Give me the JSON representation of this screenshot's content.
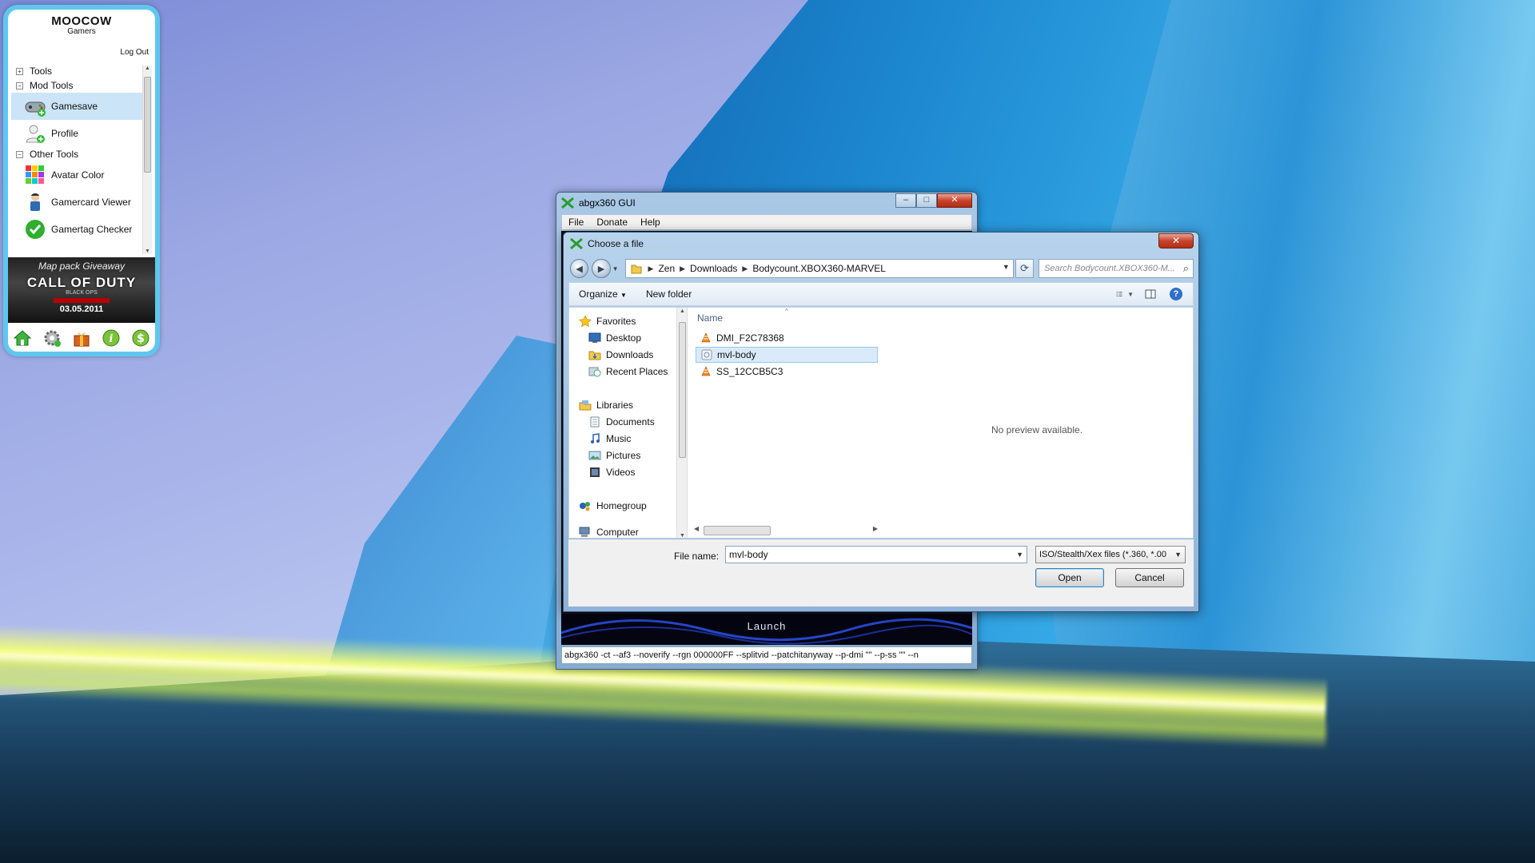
{
  "gadget": {
    "title": "MOOCOW",
    "subtitle": "Gamers",
    "logout": "Log Out",
    "groups": {
      "tools": "Tools",
      "mod_tools": "Mod Tools",
      "other_tools": "Other Tools"
    },
    "items": {
      "gamesave": "Gamesave",
      "profile": "Profile",
      "avatar_color": "Avatar Color",
      "gamercard_viewer": "Gamercard Viewer",
      "gamertag_checker": "Gamertag Checker"
    },
    "banner": {
      "top": "Map pack Giveaway",
      "game": "CALL OF DUTY",
      "sub": "BLACK OPS",
      "date": "03.05.2011"
    },
    "toolbar_icons": [
      "home-icon",
      "settings-icon",
      "gift-icon",
      "info-icon",
      "dollar-icon"
    ]
  },
  "abgx": {
    "title": "abgx360 GUI",
    "menu": [
      "File",
      "Donate",
      "Help"
    ],
    "launch": "Launch",
    "command": "abgx360 -ct --af3 --noverify --rgn 000000FF --splitvid --patchitanyway --p-dmi \"\" --p-ss \"\" --n"
  },
  "dialog": {
    "title": "Choose a file",
    "breadcrumbs": [
      "Zen",
      "Downloads",
      "Bodycount.XBOX360-MARVEL"
    ],
    "search_placeholder": "Search Bodycount.XBOX360-M...",
    "toolbar": {
      "organize": "Organize",
      "new_folder": "New folder"
    },
    "nav": {
      "favorites": "Favorites",
      "desktop": "Desktop",
      "downloads": "Downloads",
      "recent_places": "Recent Places",
      "libraries": "Libraries",
      "documents": "Documents",
      "music": "Music",
      "pictures": "Pictures",
      "videos": "Videos",
      "homegroup": "Homegroup",
      "computer": "Computer"
    },
    "column_name": "Name",
    "files": [
      "DMI_F2C78368",
      "mvl-body",
      "SS_12CCB5C3"
    ],
    "selected_file_index": 1,
    "preview_text": "No preview available.",
    "file_name_label": "File name:",
    "file_name_value": "mvl-body",
    "file_type": "ISO/Stealth/Xex files (*.360, *.00",
    "open_label": "Open",
    "cancel_label": "Cancel"
  }
}
